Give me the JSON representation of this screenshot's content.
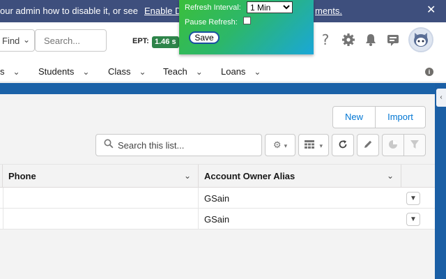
{
  "banner": {
    "message": "our admin how to disable it, or see",
    "link1": "Enable D",
    "link2": "ments.",
    "close": "✕"
  },
  "header": {
    "find_label": "Find",
    "search_placeholder": "Search...",
    "ept_label": "EPT:",
    "ept_value": "1.46 s"
  },
  "popup": {
    "refresh_label": "Refresh Interval:",
    "refresh_value": "1 Min",
    "pause_label": "Pause Refresh:",
    "save_label": "Save"
  },
  "nav": {
    "items": [
      {
        "label": "s"
      },
      {
        "label": "Students"
      },
      {
        "label": "Class"
      },
      {
        "label": "Teach"
      },
      {
        "label": "Loans"
      }
    ]
  },
  "list": {
    "new_label": "New",
    "import_label": "Import",
    "search_placeholder": "Search this list...",
    "columns": [
      {
        "label": "Phone"
      },
      {
        "label": "Account Owner Alias"
      }
    ],
    "rows": [
      {
        "phone": "",
        "owner_alias": "GSain"
      },
      {
        "phone": "",
        "owner_alias": "GSain"
      }
    ]
  },
  "colors": {
    "banner": "#3e4f7d",
    "brand_band": "#1b62a8",
    "link": "#0176d3",
    "ept_badge": "#2e844a"
  }
}
